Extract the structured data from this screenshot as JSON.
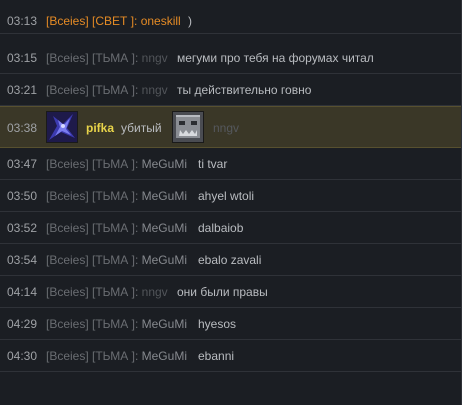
{
  "rows": [
    {
      "time": "03:13",
      "prefix": "[Всеіеs] [СВЕТ ]: ",
      "name": "oneskill",
      "message": ")"
    },
    {
      "time": "03:15",
      "prefix": "[Всеіеs] [ТЬМА ]: ",
      "name": "nngv",
      "message": "мегуми про тебя на форумах читал"
    },
    {
      "time": "03:21",
      "prefix": "[Всеіеs] [ТЬМА ]: ",
      "name": "nngv",
      "message": "ты действительно говно"
    },
    {
      "time": "03:47",
      "prefix": "[Всеіеs] [ТЬМА ]: ",
      "name": "MeGuMi",
      "message": "ti tvar"
    },
    {
      "time": "03:50",
      "prefix": "[Всеіеs] [ТЬМА ]: ",
      "name": "MeGuMi",
      "message": "ahyel wtoli"
    },
    {
      "time": "03:52",
      "prefix": "[Всеіеs] [ТЬМА ]: ",
      "name": "MeGuMi",
      "message": "dalbaiob"
    },
    {
      "time": "03:54",
      "prefix": "[Всеіеs] [ТЬМА ]: ",
      "name": "MeGuMi",
      "message": "ebalo zavali"
    },
    {
      "time": "04:14",
      "prefix": "[Всеіеs] [ТЬМА ]: ",
      "name": "nngv",
      "message": "они были правы"
    },
    {
      "time": "04:29",
      "prefix": "[Всеіеs] [ТЬМА ]: ",
      "name": "MeGuMi",
      "message": "hyesos"
    },
    {
      "time": "04:30",
      "prefix": "[Всеіеs] [ТЬМА ]: ",
      "name": "MeGuMi",
      "message": "ebanni"
    }
  ],
  "kill_event": {
    "time": "03:38",
    "killer": "pifka",
    "verb": "убитый",
    "victim": "nngv",
    "killer_icon": "dark-hero-portrait",
    "victim_icon": "stone-hero-portrait"
  },
  "colors": {
    "light_team": "#e58b25",
    "dark_team": "#6a6d72",
    "killer_name": "#e8d44a",
    "kill_row_bg": "#3a3727",
    "background": "#1b1e23"
  }
}
